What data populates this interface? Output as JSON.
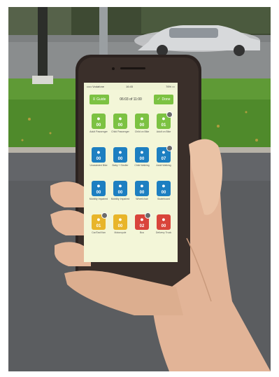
{
  "scene": {
    "description_icons": [
      "hand",
      "smartphone",
      "car",
      "road",
      "grass",
      "tree-trunk",
      "pole"
    ]
  },
  "phone": {
    "status_bar": {
      "carrier": "••••• Vodafone",
      "time": "16:45",
      "battery": "76% ▭"
    },
    "top_bar": {
      "left_button": {
        "icon": "menu-icon",
        "label": "Guide"
      },
      "counter": "06:03 of 11:00",
      "right_button": {
        "icon": "check-icon",
        "label": "Done"
      }
    },
    "tiles": [
      {
        "color": "green",
        "count": "00",
        "label": "Adult Passenger",
        "icon": "pedestrian-icon",
        "badge": false
      },
      {
        "color": "green",
        "count": "00",
        "label": "Child Passenger",
        "icon": "bike-icon",
        "badge": false
      },
      {
        "color": "green",
        "count": "00",
        "label": "Child on Bike",
        "icon": "child-bike-icon",
        "badge": false
      },
      {
        "color": "green",
        "count": "01",
        "label": "Adult on Bike",
        "icon": "adult-bike-icon",
        "badge": true
      },
      {
        "color": "blue",
        "count": "00",
        "label": "Unassisted Bike",
        "icon": "walker-icon",
        "badge": false
      },
      {
        "color": "blue",
        "count": "00",
        "label": "Baby + Stroller",
        "icon": "stroller-icon",
        "badge": false
      },
      {
        "color": "blue",
        "count": "00",
        "label": "Child Walking",
        "icon": "child-walk-icon",
        "badge": false
      },
      {
        "color": "blue",
        "count": "07",
        "label": "Adult Walking",
        "icon": "adult-walk-icon",
        "badge": true
      },
      {
        "color": "blue",
        "count": "00",
        "label": "Mobility Impaired",
        "icon": "cane-icon",
        "badge": false
      },
      {
        "color": "blue",
        "count": "00",
        "label": "Mobility Impaired",
        "icon": "walker-assist-icon",
        "badge": false
      },
      {
        "color": "blue",
        "count": "00",
        "label": "Wheelchair",
        "icon": "wheelchair-icon",
        "badge": false
      },
      {
        "color": "blue",
        "count": "00",
        "label": "Skateboard",
        "icon": "skate-icon",
        "badge": false
      },
      {
        "color": "yellow",
        "count": "01",
        "label": "Car/Taxi/Van",
        "icon": "car-icon",
        "badge": true
      },
      {
        "color": "yellow",
        "count": "00",
        "label": "Motorcycle",
        "icon": "motorcycle-icon",
        "badge": false
      },
      {
        "color": "red",
        "count": "02",
        "label": "Bus",
        "icon": "bus-icon",
        "badge": true
      },
      {
        "color": "red",
        "count": "00",
        "label": "Delivery Truck",
        "icon": "truck-icon",
        "badge": false
      }
    ]
  },
  "colors": {
    "green": "#7cc242",
    "blue": "#1d7fc1",
    "yellow": "#e8b52a",
    "red": "#d9453b",
    "screen_bg": "#f3f6d8"
  }
}
